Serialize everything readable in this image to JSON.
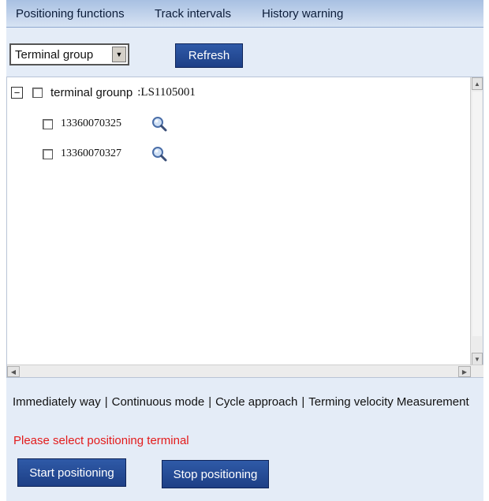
{
  "tabs": [
    {
      "label": "Positioning functions"
    },
    {
      "label": "Track intervals"
    },
    {
      "label": "History warning"
    }
  ],
  "toolbar": {
    "group_select_value": "Terminal group",
    "refresh_label": "Refresh"
  },
  "tree": {
    "group": {
      "expander": "−",
      "label": "terminal grounp",
      "code": ":LS1105001",
      "checked": false
    },
    "terminals": [
      {
        "id": "13360070325",
        "checked": false,
        "icon": "magnifier-icon"
      },
      {
        "id": "13360070327",
        "checked": false,
        "icon": "magnifier-icon"
      }
    ]
  },
  "modes": {
    "items": [
      "Immediately way",
      "Continuous mode",
      "Cycle approach",
      "Terming velocity Measurement"
    ],
    "separator": "|"
  },
  "status": {
    "warning": "Please select positioning terminal",
    "warning_color": "#e31b1b"
  },
  "actions": {
    "start_label": "Start positioning",
    "stop_label": "Stop positioning"
  },
  "colors": {
    "button_blue": "#1f4188",
    "panel_bg": "#e4ecf7"
  }
}
